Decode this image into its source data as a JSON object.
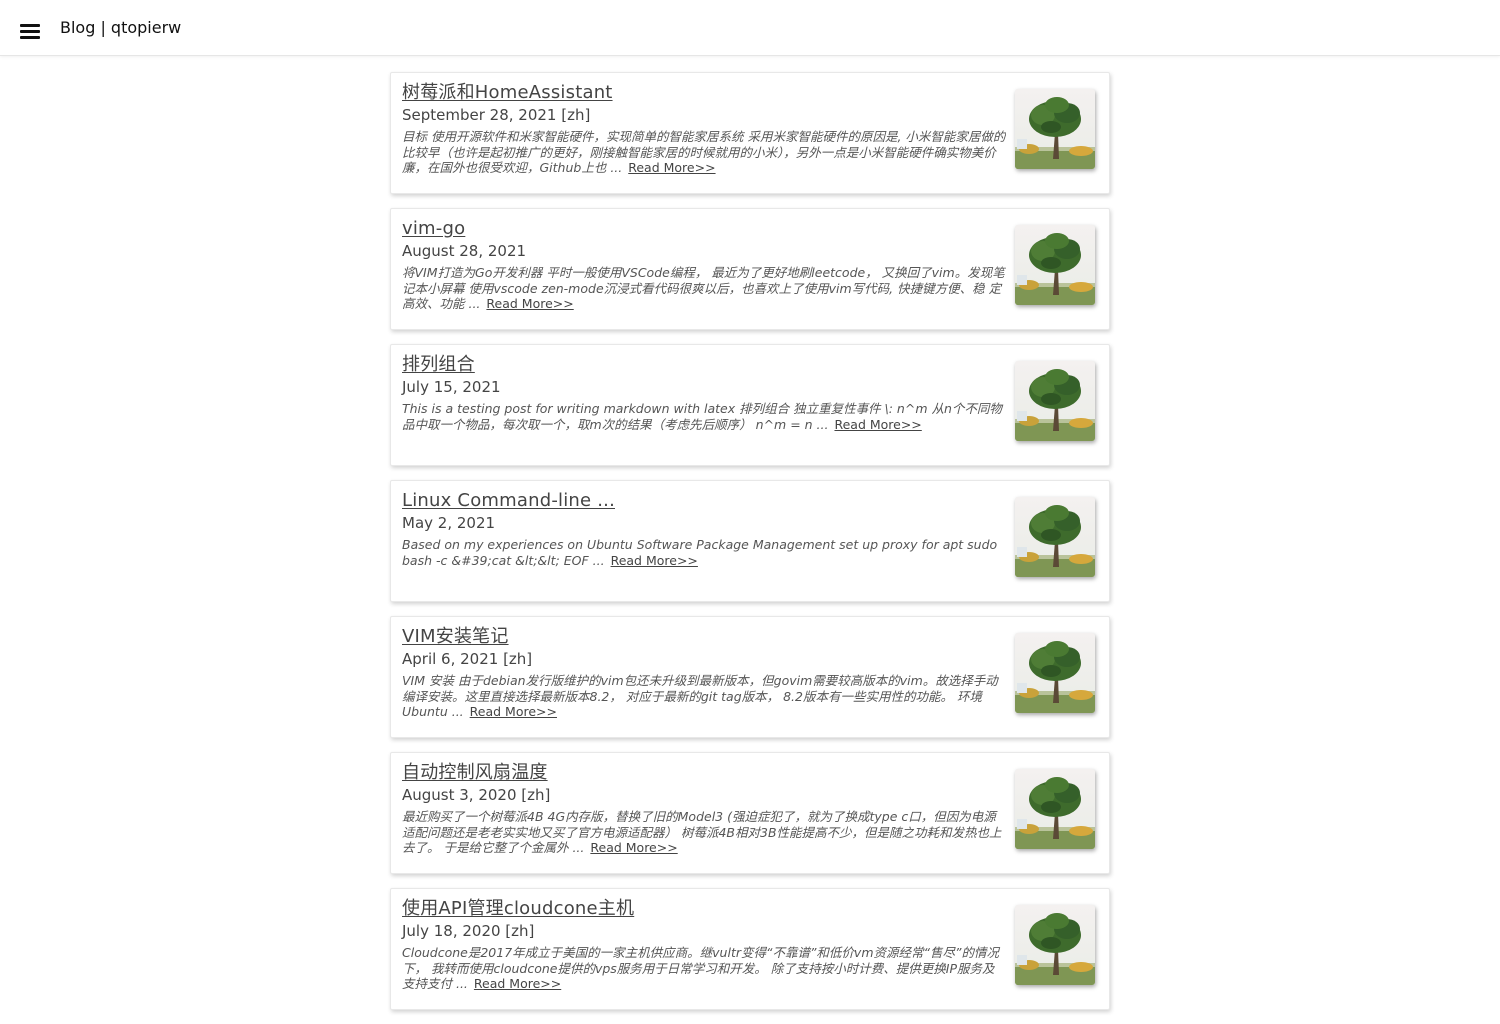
{
  "header": {
    "title": "Blog | qtopierw"
  },
  "posts": [
    {
      "title": "树莓派和HomeAssistant",
      "meta": "September 28, 2021 [zh]",
      "excerpt": "目标 使用开源软件和米家智能硬件，实现简单的智能家居系统 采用米家智能硬件的原因是, 小米智能家居做的比较早（也许是起初推广的更好，刚接触智能家居的时候就用的小米），另外一点是小米智能硬件确实物美价廉，在国外也很受欢迎，Github上也 ...",
      "read_more": "Read More>>"
    },
    {
      "title": "vim-go",
      "meta": "August 28, 2021",
      "excerpt": "将VIM打造为Go开发利器 平时一般使用VSCode编程， 最近为了更好地刷leetcode， 又换回了vim。发现笔记本小屏幕 使用vscode zen-mode沉浸式看代码很爽以后，也喜欢上了使用vim写代码, 快捷键方便、稳 定高效、功能 ...",
      "read_more": "Read More>>"
    },
    {
      "title": "排列组合",
      "meta": "July 15, 2021",
      "excerpt": "This is a testing post for writing markdown with latex 排列组合 独立重复性事件 \\: n^m 从n个不同物品中取一个物品，每次取一个，取m次的结果（考虑先后顺序） n^m = n ...",
      "read_more": "Read More>>"
    },
    {
      "title": "Linux Command-line ...",
      "meta": "May 2, 2021",
      "excerpt": "Based on my experiences on Ubuntu Software Package Management set up proxy for apt sudo bash -c &#39;cat &lt;&lt; EOF ...",
      "read_more": "Read More>>"
    },
    {
      "title": "VIM安装笔记",
      "meta": "April 6, 2021 [zh]",
      "excerpt": "VIM 安装 由于debian发行版维护的vim包还未升级到最新版本，但govim需要较高版本的vim。故选择手动编译安装。这里直接选择最新版本8.2， 对应于最新的git tag版本， 8.2版本有一些实用性的功能。 环境 Ubuntu ...",
      "read_more": "Read More>>"
    },
    {
      "title": "自动控制风扇温度",
      "meta": "August 3, 2020 [zh]",
      "excerpt": "最近购买了一个树莓派4B 4G内存版，替换了旧的Model3 (强迫症犯了，就为了换成type c口，但因为电源适配问题还是老老实实地又买了官方电源适配器） 树莓派4B相对3B性能提高不少，但是随之功耗和发热也上去了。 于是给它整了个金属外 ...",
      "read_more": "Read More>>"
    },
    {
      "title": "使用API管理cloudcone主机",
      "meta": "July 18, 2020 [zh]",
      "excerpt": "Cloudcone是2017年成立于美国的一家主机供应商。继vultr变得“不靠谱”和低价vm资源经常“售尽”的情况下， 我转而使用cloudcone提供的vps服务用于日常学习和开发。 除了支持按小时计费、提供更换IP服务及支持支付 ...",
      "read_more": "Read More>>"
    }
  ],
  "icons": {
    "menu": "hamburger-menu-icon",
    "thumbnail": "tree-thumbnail-image"
  }
}
